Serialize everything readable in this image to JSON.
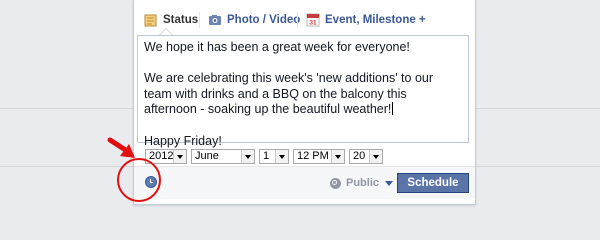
{
  "tabs": [
    {
      "label": "Status",
      "icon": "status-note-icon"
    },
    {
      "label": "Photo / Video",
      "icon": "camera-icon"
    },
    {
      "label": "Event, Milestone +",
      "icon": "calendar-icon"
    }
  ],
  "post": {
    "paragraphs": [
      "We hope it has been a great week for everyone!",
      "We are celebrating this week's 'new additions' to our team with drinks and a BBQ on the balcony this afternoon - soaking up the beautiful weather!",
      "Happy Friday!"
    ]
  },
  "schedule": {
    "year": "2012",
    "month": "June",
    "day": "1",
    "hour": "12 PM",
    "minute": "20"
  },
  "footer": {
    "clock_icon": "clock-icon",
    "privacy_label": "Public",
    "schedule_button": "Schedule"
  },
  "colors": {
    "brand": "#3b5998",
    "button": "#5b74a8",
    "annotation": "#e01010"
  }
}
